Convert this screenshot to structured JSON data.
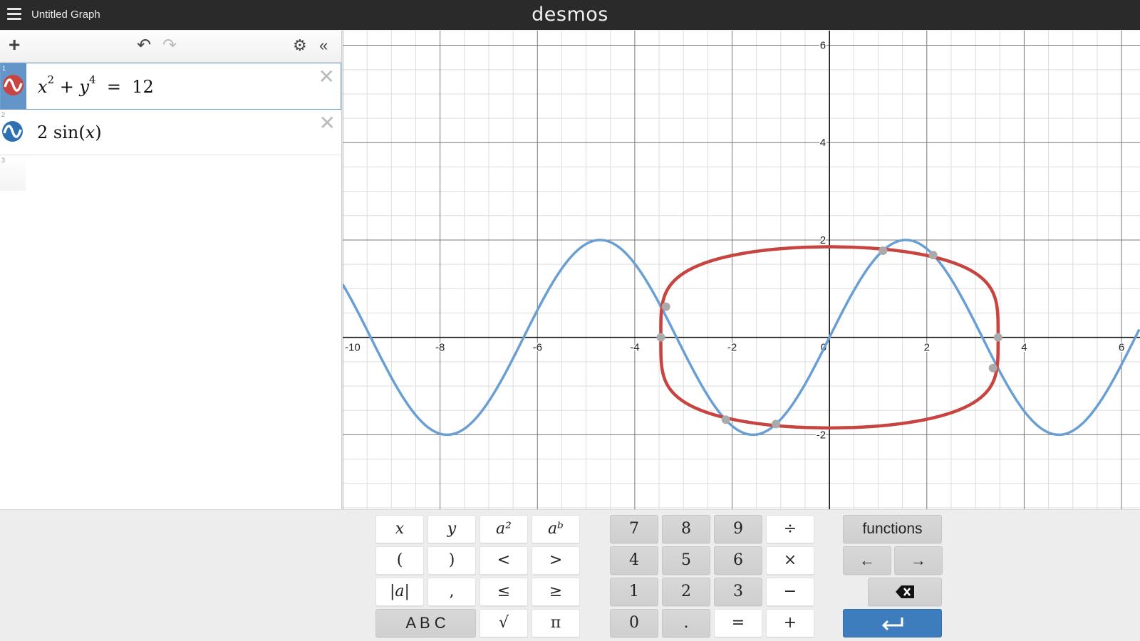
{
  "header": {
    "title": "Untitled Graph",
    "logo": "desmos"
  },
  "toolbar": {
    "add_icon": "plus-icon",
    "undo_icon": "undo-icon",
    "redo_icon": "redo-icon",
    "settings_icon": "gear-icon",
    "collapse_icon": "double-chevron-left-icon"
  },
  "expressions": [
    {
      "index": "1",
      "latex": "x^2 + y^4 = 12",
      "color": "#c74440",
      "active": true
    },
    {
      "index": "2",
      "latex": "2 sin(x)",
      "color": "#2d70b3",
      "active": false
    },
    {
      "index": "3",
      "latex": "",
      "active": false
    }
  ],
  "graph": {
    "x_range": [
      -10,
      6.38
    ],
    "y_range": [
      -3.53,
      6.3
    ],
    "x_tick_labels": [
      "-10",
      "-8",
      "-6",
      "-4",
      "-2",
      "0",
      "2",
      "4",
      "6"
    ],
    "y_tick_labels": [
      "6",
      "4",
      "2",
      "-2"
    ],
    "grid_minor": 0.5,
    "grid_major": 2,
    "curve_colors": {
      "implicit": "#c74440",
      "sine": "#6a9fd4"
    },
    "intersection_color": "#aaaaaa"
  },
  "chart_data": {
    "type": "line",
    "title": "",
    "xlabel": "",
    "ylabel": "",
    "xlim": [
      -10,
      6.38
    ],
    "ylim": [
      -3.53,
      6.3
    ],
    "grid": true,
    "series": [
      {
        "name": "x^2 + y^4 = 12",
        "kind": "implicit",
        "color": "#c74440"
      },
      {
        "name": "2 sin(x)",
        "kind": "function",
        "color": "#6a9fd4"
      }
    ],
    "intersections": [
      {
        "x": -3.36,
        "y": 0.63
      },
      {
        "x": -2.13,
        "y": -1.69
      },
      {
        "x": -1.1,
        "y": -1.78
      },
      {
        "x": 1.1,
        "y": 1.78
      },
      {
        "x": 2.13,
        "y": 1.69
      },
      {
        "x": 3.36,
        "y": -0.63
      }
    ],
    "x_intercepts_implicit": [
      {
        "x": -3.464,
        "y": 0
      },
      {
        "x": 3.464,
        "y": 0
      }
    ]
  },
  "keypad": {
    "left": [
      [
        "x",
        "y",
        "a²",
        "aᵇ"
      ],
      [
        "(",
        ")",
        "<",
        ">"
      ],
      [
        "|a|",
        ",",
        "≤",
        "≥"
      ],
      [
        "A B C",
        "√",
        "π"
      ]
    ],
    "numpad": [
      [
        "7",
        "8",
        "9",
        "÷"
      ],
      [
        "4",
        "5",
        "6",
        "×"
      ],
      [
        "1",
        "2",
        "3",
        "−"
      ],
      [
        "0",
        ".",
        "=",
        "+"
      ]
    ],
    "right": {
      "functions": "functions",
      "left_arrow": "←",
      "right_arrow": "→",
      "backspace_icon": "backspace-icon",
      "enter_icon": "enter-icon"
    }
  },
  "keyboard_toggle_icon": "keyboard-icon"
}
